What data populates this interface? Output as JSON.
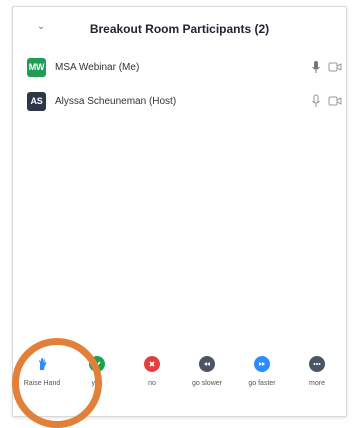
{
  "header": {
    "title": "Breakout Room Participants (2)"
  },
  "participants": [
    {
      "initials": "MW",
      "name": "MSA Webinar (Me)",
      "color": "#1f9d55",
      "mic_state": "active"
    },
    {
      "initials": "AS",
      "name": "Alyssa Scheuneman (Host)",
      "color": "#2d3748",
      "mic_state": "muted"
    }
  ],
  "reactions": [
    {
      "label": "Raise Hand",
      "icon": "raise-hand-icon",
      "color": "#2d8cff"
    },
    {
      "label": "yes",
      "icon": "check-icon",
      "color": "#19a34a"
    },
    {
      "label": "no",
      "icon": "x-icon",
      "color": "#e53e3e"
    },
    {
      "label": "go slower",
      "icon": "rewind-icon",
      "color": "#4b5563"
    },
    {
      "label": "go faster",
      "icon": "fast-forward-icon",
      "color": "#2d8cff"
    },
    {
      "label": "more",
      "icon": "ellipsis-icon",
      "color": "#4b5563"
    }
  ],
  "colors": {
    "highlight": "#e2803a"
  }
}
